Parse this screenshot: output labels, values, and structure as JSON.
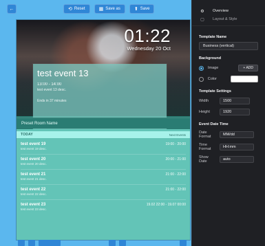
{
  "toolbar": {
    "back_icon": "arrow-left",
    "reset_label": "Reset",
    "save_as_label": "Save as",
    "save_label": "Save",
    "accent": "#2f86d6"
  },
  "preview": {
    "clock": {
      "time": "01:22",
      "date": "Wednesday 20 Oct"
    },
    "current_event": {
      "title": "test event 13",
      "time": "13:00 - 14:00",
      "description": "test event 13 desc.",
      "ends_in": "Ends in 37 minutes"
    },
    "room_name": "Preset Room Name",
    "today": {
      "label": "TODAY",
      "right": "Next Events"
    },
    "events": [
      {
        "name": "test event 19",
        "time": "19:00 - 20:00",
        "desc": "test event 19 desc."
      },
      {
        "name": "test event 20",
        "time": "20:00 - 21:00",
        "desc": "test event 20 desc."
      },
      {
        "name": "test event 21",
        "time": "21:00 - 22:00",
        "desc": "test event 21 desc."
      },
      {
        "name": "test event 22",
        "time": "21:00 - 22:00",
        "desc": "test event 22 desc."
      },
      {
        "name": "test event 23",
        "time": "19.02 22:00 - 19.07 00:00",
        "desc": "test event 23 desc."
      }
    ],
    "colors": {
      "teal": "#63c4b7",
      "teal_dark": "#2a7c73",
      "today_bar": "#a7f2ea"
    }
  },
  "side": {
    "tabs": [
      {
        "icon": "settings-icon",
        "label": "Overview",
        "active": true
      },
      {
        "icon": "layout-icon",
        "label": "Layout & Style",
        "active": false
      }
    ],
    "template_name": {
      "title": "Template Name",
      "value": "Business (vertical)"
    },
    "background": {
      "title": "Background",
      "options": [
        {
          "label": "Image",
          "selected": true,
          "action_label": "+ ADD"
        },
        {
          "label": "Color",
          "selected": false,
          "color": "#ffffff"
        }
      ]
    },
    "template_settings": {
      "title": "Template Settings",
      "width_label": "Width",
      "width_value": "1500",
      "height_label": "Height",
      "height_value": "1920"
    },
    "event_datetime": {
      "title": "Event Date Time",
      "date_format_label": "Date Format",
      "date_format_value": "MM/dd",
      "time_format_label": "Time Format",
      "time_format_value": "HH:mm",
      "show_date_label": "Show Date",
      "show_date_value": "auto"
    }
  }
}
